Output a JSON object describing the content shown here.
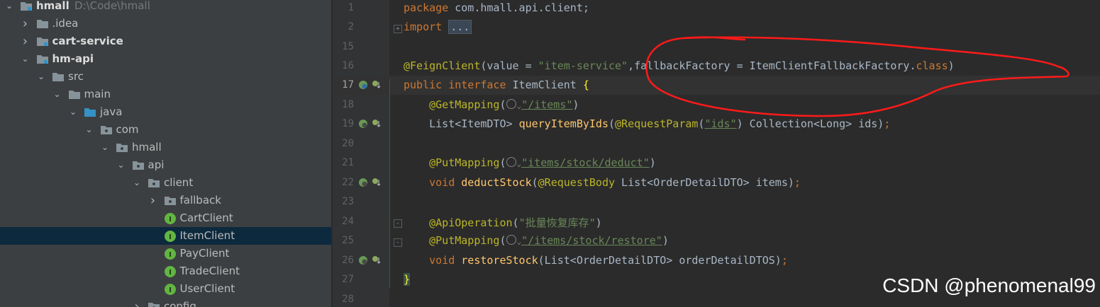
{
  "project_tree": {
    "root": {
      "label": "hmall",
      "path": "D:\\Code\\hmall"
    },
    "items": [
      {
        "label": "hmall",
        "path": "D:\\Code\\hmall",
        "level": 0,
        "expanded": true,
        "bold": true,
        "icon": "module-folder-icon"
      },
      {
        "label": ".idea",
        "level": 1,
        "expanded": false,
        "icon": "folder-icon"
      },
      {
        "label": "cart-service",
        "level": 1,
        "expanded": false,
        "bold": true,
        "icon": "module-folder-icon"
      },
      {
        "label": "hm-api",
        "level": 1,
        "expanded": true,
        "bold": true,
        "icon": "module-folder-icon"
      },
      {
        "label": "src",
        "level": 2,
        "expanded": true,
        "icon": "folder-icon"
      },
      {
        "label": "main",
        "level": 3,
        "expanded": true,
        "icon": "folder-icon"
      },
      {
        "label": "java",
        "level": 4,
        "expanded": true,
        "icon": "source-folder-icon"
      },
      {
        "label": "com",
        "level": 5,
        "expanded": true,
        "icon": "package-icon"
      },
      {
        "label": "hmall",
        "level": 6,
        "expanded": true,
        "icon": "package-icon"
      },
      {
        "label": "api",
        "level": 7,
        "expanded": true,
        "icon": "package-icon"
      },
      {
        "label": "client",
        "level": 8,
        "expanded": true,
        "icon": "package-icon"
      },
      {
        "label": "fallback",
        "level": 9,
        "expanded": false,
        "icon": "package-icon"
      },
      {
        "label": "CartClient",
        "level": 9,
        "icon": "interface-icon"
      },
      {
        "label": "ItemClient",
        "level": 9,
        "icon": "interface-icon",
        "selected": true
      },
      {
        "label": "PayClient",
        "level": 9,
        "icon": "interface-icon"
      },
      {
        "label": "TradeClient",
        "level": 9,
        "icon": "interface-icon"
      },
      {
        "label": "UserClient",
        "level": 9,
        "icon": "interface-icon"
      },
      {
        "label": "config",
        "level": 8,
        "expanded": false,
        "icon": "package-icon"
      }
    ]
  },
  "editor": {
    "line_numbers": [
      "1",
      "2",
      "15",
      "16",
      "17",
      "18",
      "19",
      "20",
      "21",
      "22",
      "23",
      "24",
      "25",
      "26",
      "27",
      "28"
    ],
    "current_line": "17",
    "code": {
      "l1_kw": "package",
      "l1_rest": " com.hmall.api.client;",
      "l2_kw": "import",
      "l2_fold": "...",
      "l16_ann": "@FeignClient",
      "l16_a": "(value = ",
      "l16_str": "\"item-service\"",
      "l16_b": ",fallbackFactory = ItemClientFallbackFactory.",
      "l16_kw": "class",
      "l16_c": ")",
      "l17_kw1": "public",
      "l17_kw2": "interface",
      "l17_name": " ItemClient ",
      "l17_brace": "{",
      "l18_ann": "@GetMapping",
      "l18_a": "(",
      "l18_str": "\"/items\"",
      "l18_b": ")",
      "l19_a": "List<ItemDTO> ",
      "l19_me": "queryItemByIds",
      "l19_b": "(",
      "l19_ann": "@RequestParam",
      "l19_c": "(",
      "l19_str": "\"ids\"",
      "l19_d": ") Collection<Long> ids)",
      "l19_semi": ";",
      "l21_ann": "@PutMapping",
      "l21_a": "(",
      "l21_str": "\"items/stock/deduct\"",
      "l21_b": ")",
      "l22_kw": "void",
      "l22_me": " deductStock",
      "l22_a": "(",
      "l22_ann": "@RequestBody",
      "l22_b": " List<OrderDetailDTO> items)",
      "l22_semi": ";",
      "l24_ann": "@ApiOperation",
      "l24_a": "(",
      "l24_str": "\"批量恢复库存\"",
      "l24_b": ")",
      "l25_ann": "@PutMapping",
      "l25_a": "(",
      "l25_str": "\"/items/stock/restore\"",
      "l25_b": ")",
      "l26_kw": "void",
      "l26_me": " restoreStock",
      "l26_a": "(List<OrderDetailDTO> orderDetailDTOS)",
      "l26_semi": ";",
      "l27_brace": "}"
    }
  },
  "watermark": "CSDN @phenomenal99",
  "colors": {
    "keyword": "#cc7832",
    "annotation": "#bbb529",
    "string": "#6a8759",
    "method": "#ffc66d",
    "highlight_circle": "#ff1a1a"
  }
}
